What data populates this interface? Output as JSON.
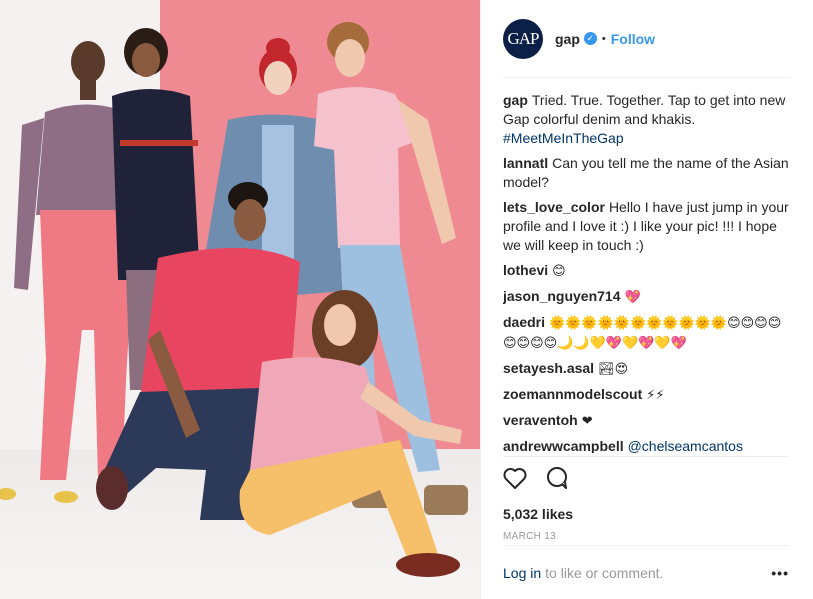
{
  "post": {
    "image_alt": "Seven models in colorful denim and khakis",
    "account": {
      "avatar_text": "GAP",
      "username": "gap",
      "verified_mark": "✓",
      "separator": "•",
      "follow_label": "Follow"
    },
    "caption": {
      "user": "gap",
      "text": "Tried. True. Together. Tap to get into new Gap colorful denim and khakis.",
      "hashtag": "#MeetMeInTheGap"
    },
    "comments": [
      {
        "user": "lannatl",
        "text": "Can you tell me the name of the Asian model?"
      },
      {
        "user": "lets_love_color",
        "text": "Hello I have just jump in your profile and I love it :) I like your pic! !!! I hope we will keep in touch :)"
      },
      {
        "user": "lothevi",
        "text": "😊"
      },
      {
        "user": "jason_nguyen714",
        "text": "💖"
      },
      {
        "user": "daedri",
        "text": "🌞🌞🌞🌞🌞🌞🌞🌞🌞🌞🌞😊😊😊😊😊😊😊😊🌙🌙💛💖💛💖💛💖"
      },
      {
        "user": "setayesh.asal",
        "text": "🏞😍"
      },
      {
        "user": "zoemannmodelscout",
        "text": "⚡⚡"
      },
      {
        "user": "veraventoh",
        "text": "❤"
      },
      {
        "user": "andrewwcampbell",
        "mention": "@chelseamcantos"
      }
    ],
    "likes": "5,032 likes",
    "date": "MARCH 13",
    "login_link": "Log in",
    "login_text": "to like or comment.",
    "more_label": "•••",
    "icons": [
      "heart-icon",
      "comment-icon"
    ],
    "colors": {
      "accent": "#3897f0",
      "link": "#003569",
      "wall": "#ef8a92"
    }
  }
}
